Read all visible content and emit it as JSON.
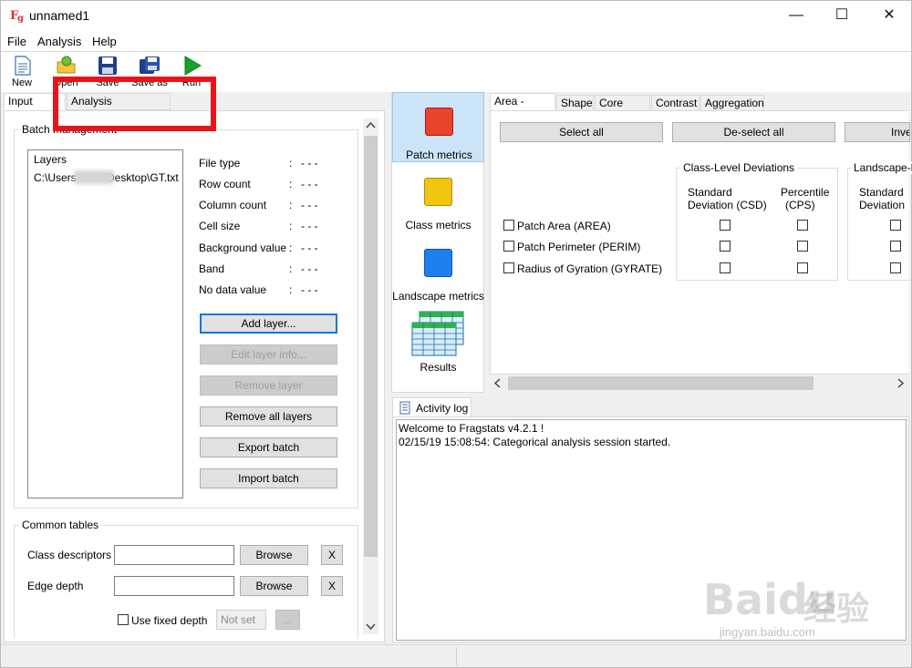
{
  "window": {
    "title": "unnamed1",
    "controls": [
      "—",
      "☐",
      "✕"
    ]
  },
  "menu": [
    "File",
    "Analysis",
    "Help"
  ],
  "toolbar": [
    {
      "label": "New",
      "icon": "new-document-icon"
    },
    {
      "label": "Open",
      "icon": "open-folder-icon"
    },
    {
      "label": "Save",
      "icon": "save-disk-icon"
    },
    {
      "label": "Save as",
      "icon": "save-as-disk-icon"
    },
    {
      "label": "Run",
      "icon": "run-play-icon"
    }
  ],
  "left_tabs": [
    "Input layers",
    "Analysis parameters"
  ],
  "batch": {
    "title": "Batch management",
    "layers_header": "Layers",
    "layer_path": "C:\\Users\\        \\Desktop\\GT.txt",
    "props": [
      {
        "label": "File type",
        "value": "- - -"
      },
      {
        "label": "Row count",
        "value": "- - -"
      },
      {
        "label": "Column count",
        "value": "- - -"
      },
      {
        "label": "Cell size",
        "value": "- - -"
      },
      {
        "label": "Background value",
        "value": "- - -"
      },
      {
        "label": "Band",
        "value": "- - -"
      },
      {
        "label": "No data value",
        "value": "- - -"
      }
    ],
    "colon": ":",
    "buttons": {
      "add": "Add layer...",
      "edit": "Edit layer info...",
      "remove": "Remove layer",
      "remove_all": "Remove all layers",
      "export": "Export batch",
      "import": "Import batch"
    }
  },
  "common": {
    "title": "Common tables",
    "class_desc": "Class descriptors",
    "edge_depth": "Edge depth",
    "browse": "Browse",
    "x": "X",
    "use_fixed": "Use fixed depth",
    "not_set": "Not set",
    "ellipsis": "..."
  },
  "metric_nav": [
    {
      "label": "Patch metrics",
      "color": "#e8432b",
      "icon": "patch-metrics-icon"
    },
    {
      "label": "Class metrics",
      "color": "#f1c40f",
      "icon": "class-metrics-icon"
    },
    {
      "label": "Landscape metrics",
      "color": "#1e7ff0",
      "icon": "landscape-metrics-icon"
    },
    {
      "label": "Results",
      "color": "#38a4e0",
      "icon": "results-table-icon"
    }
  ],
  "metric_tabs": [
    "Area - Edge",
    "Shape",
    "Core area",
    "Contrast",
    "Aggregation"
  ],
  "metric_buttons": {
    "select_all": "Select all",
    "deselect_all": "De-select all",
    "invert": "Inve"
  },
  "deviations": {
    "class_title": "Class-Level Deviations",
    "land_title": "Landscape-l",
    "std": "Standard",
    "dev_csd": "Deviation  (CSD)",
    "pct": "Percentile",
    "cps": "(CPS)",
    "land_std": "Standard",
    "land_dev": "Deviation"
  },
  "metrics": [
    "Patch Area  (AREA)",
    "Patch Perimeter  (PERIM)",
    "Radius of Gyration  (GYRATE)"
  ],
  "activity": {
    "tab": "Activity log",
    "lines": [
      "Welcome to Fragstats v4.2.1 !",
      "02/15/19 15:08:54: Categorical analysis session started."
    ]
  },
  "watermark": {
    "text1": "Bai",
    "text2": "du",
    "text3": "经验",
    "url": "jingyan.baidu.com"
  },
  "annotation_color": "#e8141b"
}
